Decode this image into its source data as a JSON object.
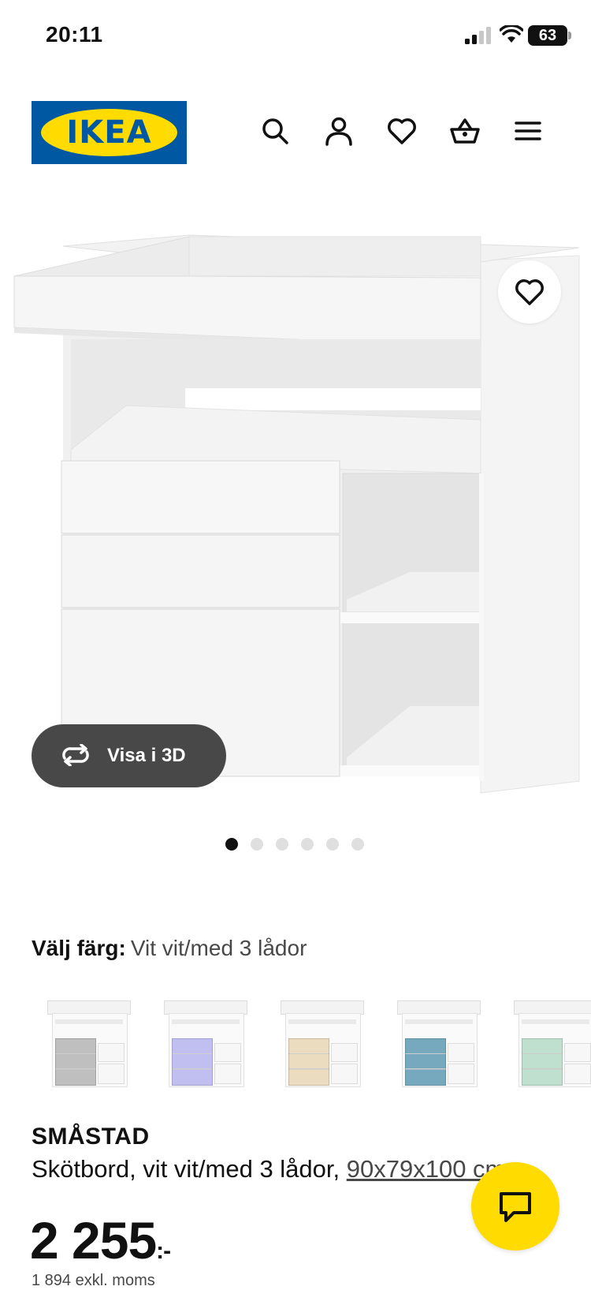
{
  "status_bar": {
    "time": "20:11",
    "battery": "63"
  },
  "header": {
    "logo_text": "IKEA",
    "icons": [
      "search-icon",
      "user-icon",
      "heart-icon",
      "basket-icon",
      "menu-icon"
    ]
  },
  "gallery": {
    "view_3d_label": "Visa i 3D",
    "dots_total": 6,
    "dots_active": 1
  },
  "color_picker": {
    "label": "Välj färg:",
    "value": "Vit vit/med 3 lådor",
    "swatches": [
      {
        "color": "#bfbfbf"
      },
      {
        "color": "#c1bff0"
      },
      {
        "color": "#ecdcbf"
      },
      {
        "color": "#76a8be"
      },
      {
        "color": "#bfe0cf"
      }
    ]
  },
  "product": {
    "name": "SMÅSTAD",
    "description": "Skötbord, vit vit/med 3 lådor, ",
    "size_link": "90x79x100 cm",
    "price": "2 255",
    "price_suffix": ":-",
    "sub_text": "1 894 exkl. moms"
  },
  "colors": {
    "ikea_blue": "#0058a3",
    "ikea_yellow": "#ffdb00",
    "dark_button": "#484848"
  }
}
